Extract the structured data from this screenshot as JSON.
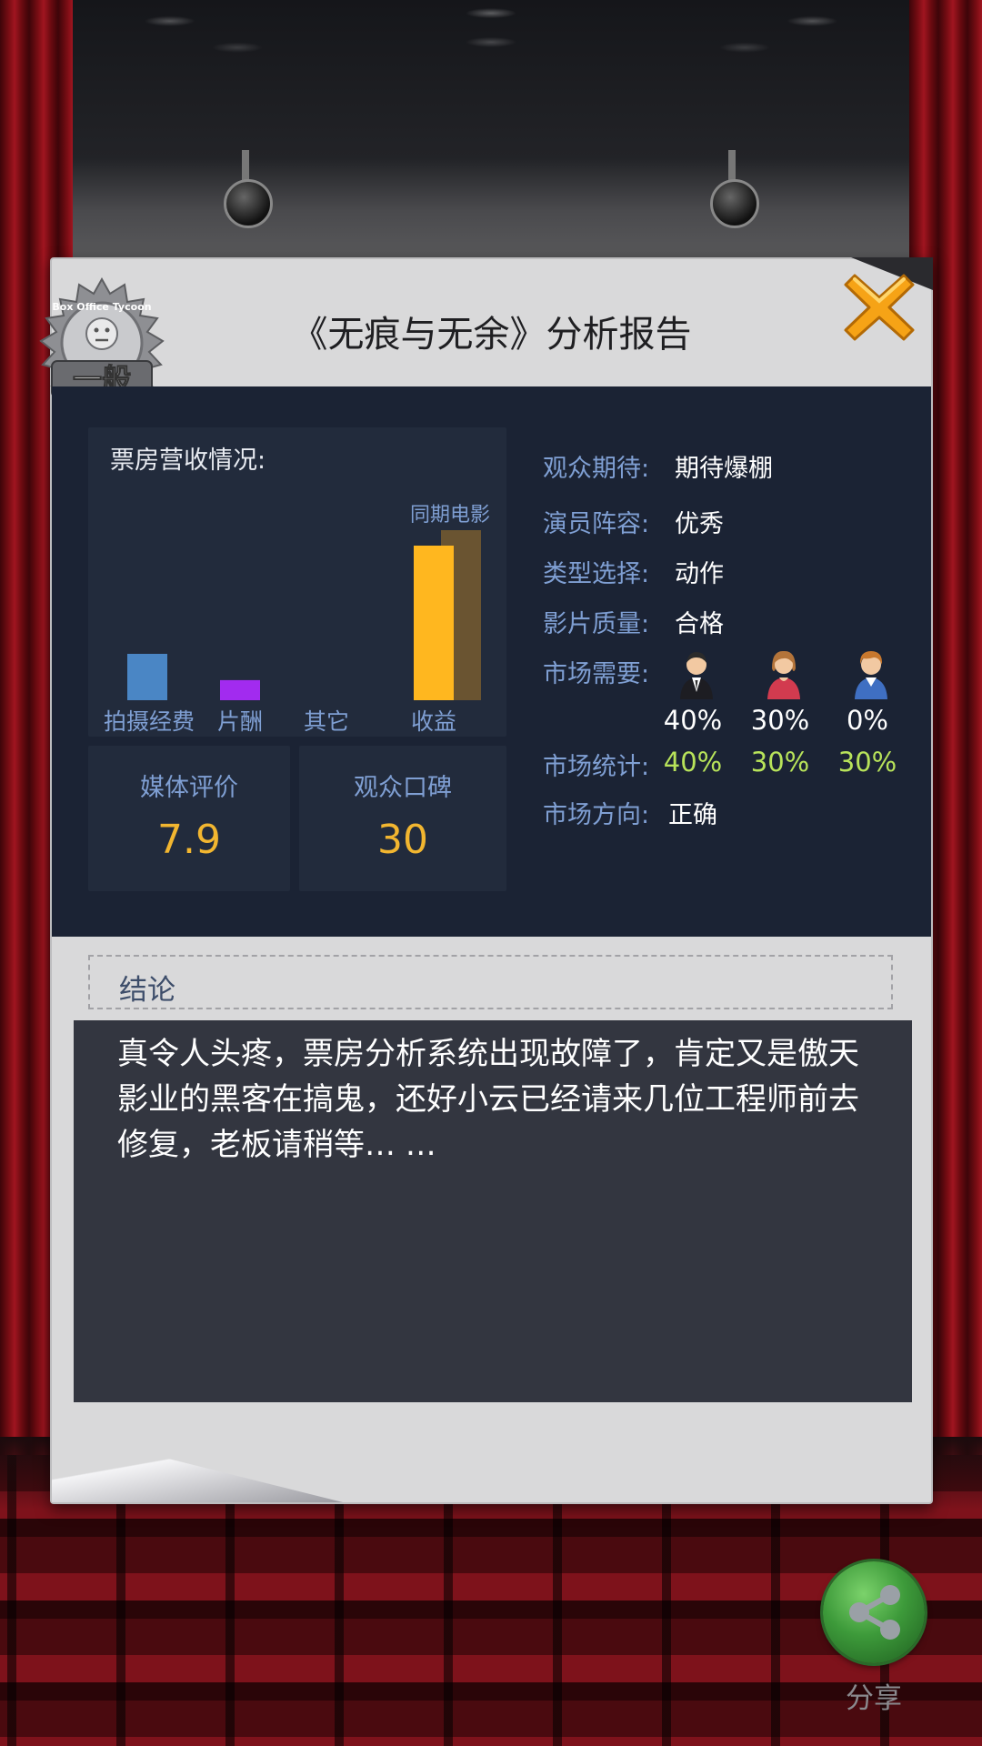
{
  "header": {
    "title": "《无痕与无余》分析报告",
    "rating_badge": "一般",
    "badge_brand": "Box Office Tycoon"
  },
  "box_office": {
    "title": "票房营收情况:",
    "legend_same_period": "同期电影",
    "categories": [
      "拍摄经费",
      "片酬",
      "其它",
      "收益"
    ]
  },
  "chart_data": {
    "type": "bar",
    "title": "票房营收情况:",
    "categories": [
      "拍摄经费",
      "片酬",
      "其它",
      "收益"
    ],
    "series": [
      {
        "name": "",
        "values": [
          0.3,
          0.13,
          0,
          1.0
        ],
        "colors": [
          "#4a86c5",
          "#a22bef",
          "#a22bef",
          "#ffb71f"
        ]
      },
      {
        "name": "同期电影",
        "values": [
          null,
          null,
          null,
          1.1
        ],
        "colors": [
          "#6a5431"
        ]
      }
    ],
    "ylim": [
      0,
      1.2
    ],
    "grid": false,
    "legend": "top-right"
  },
  "scores": {
    "media_label": "媒体评价",
    "media_value": "7.9",
    "word_label": "观众口碑",
    "word_value": "30"
  },
  "info": {
    "expectation_key": "观众期待:",
    "expectation_val": "期待爆棚",
    "cast_key": "演员阵容:",
    "cast_val": "优秀",
    "genre_key": "类型选择:",
    "genre_val": "动作",
    "quality_key": "影片质量:",
    "quality_val": "合格",
    "demand_key": "市场需要:",
    "demand_pct": [
      "40%",
      "30%",
      "0%"
    ],
    "stats_key": "市场统计:",
    "stats_pct": [
      "40%",
      "30%",
      "30%"
    ],
    "direction_key": "市场方向:",
    "direction_val": "正确"
  },
  "conclusion": {
    "heading": "结论",
    "text": "真令人头疼，票房分析系统出现故障了，肯定又是傲天影业的黑客在搞鬼，还好小云已经请来几位工程师前去修复，老板请稍等… …"
  },
  "share": {
    "label": "分享"
  },
  "colors": {
    "accent_value": "#f2b630",
    "label_blue": "#7f9fd3",
    "green_stat": "#b8e35a",
    "panel_bg": "#1b2334"
  },
  "icons": [
    "rating-badge-icon",
    "close-icon",
    "man-suit-icon",
    "woman-icon",
    "boy-icon",
    "share-icon",
    "spotlight-icon"
  ]
}
